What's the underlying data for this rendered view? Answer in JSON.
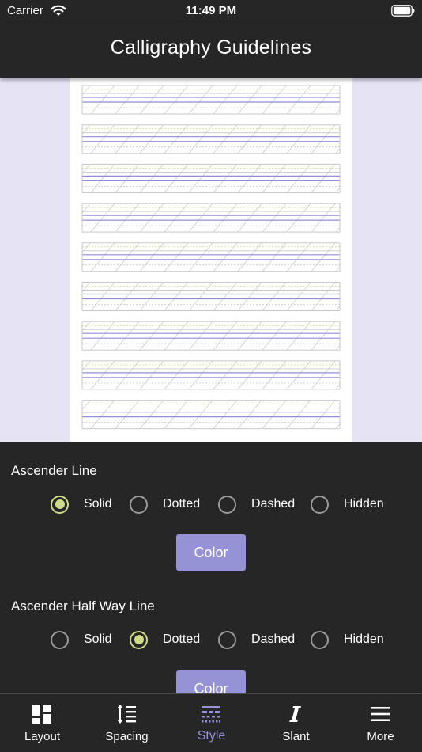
{
  "status_bar": {
    "carrier": "Carrier",
    "time": "11:49 PM"
  },
  "nav": {
    "title": "Calligraphy Guidelines"
  },
  "sections": [
    {
      "title": "Ascender Line",
      "options": [
        "Solid",
        "Dotted",
        "Dashed",
        "Hidden"
      ],
      "selected": "Solid",
      "color_label": "Color"
    },
    {
      "title": "Ascender Half Way Line",
      "options": [
        "Solid",
        "Dotted",
        "Dashed",
        "Hidden"
      ],
      "selected": "Dotted",
      "color_label": "Color"
    }
  ],
  "tabs": [
    {
      "label": "Layout",
      "icon": "layout-icon"
    },
    {
      "label": "Spacing",
      "icon": "spacing-icon"
    },
    {
      "label": "Style",
      "icon": "style-icon"
    },
    {
      "label": "Slant",
      "icon": "slant-icon"
    },
    {
      "label": "More",
      "icon": "hamburger-menu-icon"
    }
  ],
  "active_tab": "Style",
  "colors": {
    "background": "#262626",
    "accent": "#9592d6",
    "radio_selected": "#cfd98a",
    "preview_background": "#e5e3f4",
    "guide_line": "#8f8cd8"
  }
}
